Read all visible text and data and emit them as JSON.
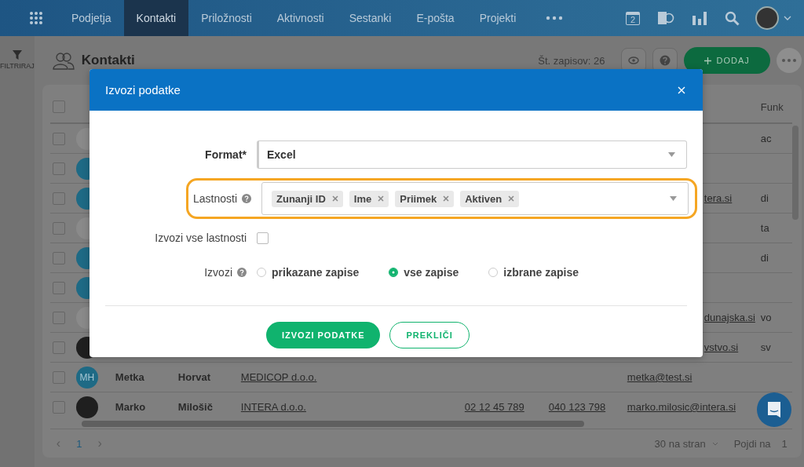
{
  "nav": {
    "items": [
      {
        "label": "Podjetja",
        "selected": false
      },
      {
        "label": "Kontakti",
        "selected": true
      },
      {
        "label": "Priložnosti",
        "selected": false
      },
      {
        "label": "Aktivnosti",
        "selected": false
      },
      {
        "label": "Sestanki",
        "selected": false
      },
      {
        "label": "E-pošta",
        "selected": false
      },
      {
        "label": "Projekti",
        "selected": false
      }
    ],
    "calendar_day": "2"
  },
  "sidebar": {
    "filter_label": "FILTRIRAJ"
  },
  "page": {
    "title": "Kontakti",
    "record_count": "Št. zapisov: 26",
    "add_button": "DODAJ"
  },
  "table": {
    "select_all_checked": false,
    "columns": [
      "Funk"
    ],
    "rows": [
      {
        "checked": false,
        "color": "#8a8a8a",
        "initials": "",
        "first": "",
        "last": "",
        "company": "",
        "phone": "",
        "mobile": "",
        "email": "",
        "function": "ac"
      },
      {
        "checked": false,
        "color": "#1e6a85",
        "initials": "",
        "first": "",
        "last": "",
        "company": "",
        "phone": "",
        "mobile": "",
        "email": "",
        "function": ""
      },
      {
        "checked": false,
        "color": "#1e6a85",
        "initials": "",
        "first": "",
        "last": "",
        "company": "",
        "phone": "",
        "mobile": "",
        "email": "tera.si",
        "function": "di"
      },
      {
        "checked": false,
        "color": "#8a8a8a",
        "initials": "",
        "first": "",
        "last": "",
        "company": "",
        "phone": "",
        "mobile": "",
        "email": "",
        "function": "ta"
      },
      {
        "checked": false,
        "color": "#1e6a85",
        "initials": "",
        "first": "",
        "last": "",
        "company": "",
        "phone": "",
        "mobile": "",
        "email": "",
        "function": "di"
      },
      {
        "checked": false,
        "color": "#1e6a85",
        "initials": "",
        "first": "",
        "last": "",
        "company": "",
        "phone": "",
        "mobile": "",
        "email": "",
        "function": ""
      },
      {
        "checked": false,
        "color": "#8a8a8a",
        "initials": "",
        "first": "",
        "last": "",
        "company": "",
        "phone": "",
        "mobile": "",
        "email": "dunajska.si",
        "function": "vo"
      },
      {
        "checked": false,
        "color": "#1f1f1f",
        "initials": "",
        "first": "",
        "last": "",
        "company": "",
        "phone": "",
        "mobile": "",
        "email": "vstvo.si",
        "function": "sv"
      },
      {
        "checked": false,
        "color": "#1e6a85",
        "initials": "MH",
        "first": "Metka",
        "last": "Horvat",
        "company": "MEDICOP d.o.o.",
        "phone": "",
        "mobile": "",
        "email": "metka@test.si",
        "function": ""
      },
      {
        "checked": false,
        "color": "#1f1f1f",
        "initials": "",
        "first": "Marko",
        "last": "Milošič",
        "company": "INTERA d.o.o.",
        "phone": "02 12 45 789",
        "mobile": "040 123 798",
        "email": "marko.milosic@intera.si",
        "function": ""
      }
    ]
  },
  "pagination": {
    "prev": "‹",
    "page": "1",
    "next": "›",
    "per_page": "30 na stran",
    "goto_label": "Pojdi na",
    "goto_value": "1"
  },
  "modal": {
    "title": "Izvozi podatke",
    "format": {
      "label": "Format*",
      "value": "Excel"
    },
    "properties": {
      "label": "Lastnosti",
      "highlighted": true,
      "tags": [
        "Zunanji ID",
        "Ime",
        "Priimek",
        "Aktiven"
      ]
    },
    "export_all": {
      "label": "Izvozi vse lastnosti",
      "checked": false
    },
    "scope": {
      "label": "Izvozi",
      "options": [
        {
          "label": "prikazane zapise",
          "selected": false
        },
        {
          "label": "vse zapise",
          "selected": true
        },
        {
          "label": "izbrane zapise",
          "selected": false
        }
      ]
    },
    "primary_button": "IZVOZI PODATKE",
    "secondary_button": "PREKLIČI"
  }
}
